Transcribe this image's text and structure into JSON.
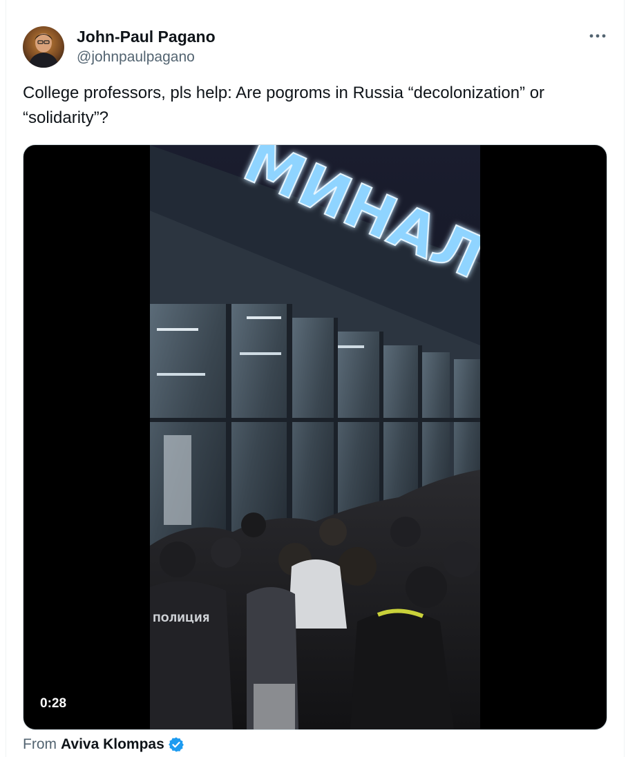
{
  "tweet": {
    "author": {
      "name": "John-Paul Pagano",
      "handle": "@johnpaulpagano"
    },
    "text": "College professors, pls help: Are pogroms in Russia “decolonization” or “solidarity”?",
    "video": {
      "duration": "0:28",
      "sign_text": "МИНАЛ В ТЕ",
      "jacket_text": "ПОЛИЦИЯ"
    },
    "source": {
      "prefix": "From",
      "name": "Aviva Klompas",
      "verified_icon": "verified-badge-icon"
    },
    "more_icon": "more-options-icon"
  },
  "colors": {
    "text_primary": "#0f1419",
    "text_secondary": "#536471",
    "verified_blue": "#1d9bf0",
    "border": "#cfd9de",
    "sign_glow": "#6fc8ff"
  }
}
